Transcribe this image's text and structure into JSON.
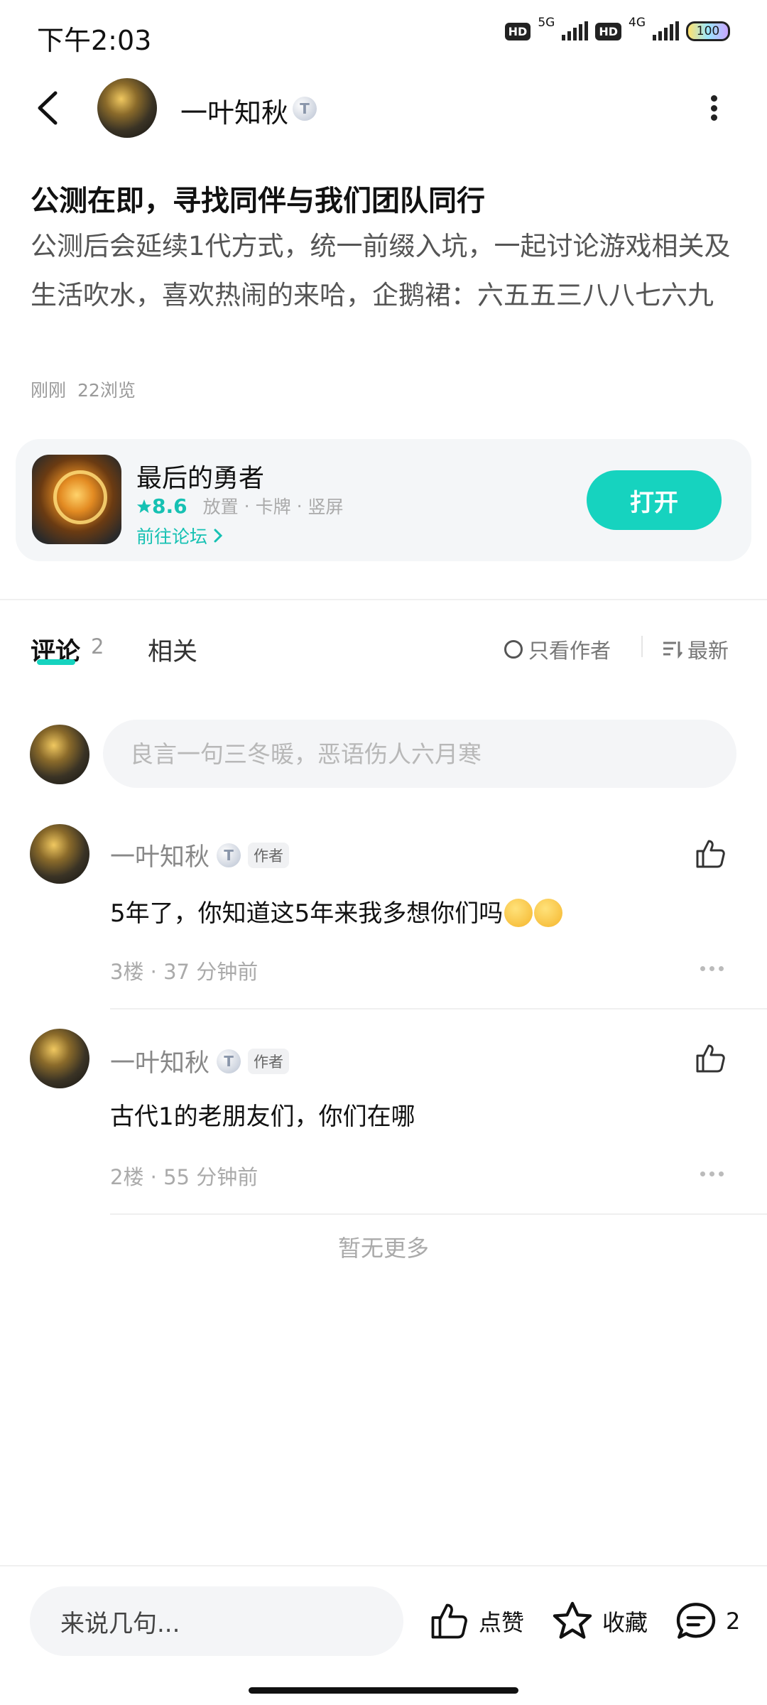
{
  "status_bar": {
    "time": "下午2:03",
    "hd1": "HD",
    "net1": "5G",
    "hd2": "HD",
    "net2": "4G",
    "battery": "100"
  },
  "header": {
    "username": "一叶知秋",
    "level_badge": "T"
  },
  "post": {
    "title": "公测在即，寻找同伴与我们团队同行",
    "body": "公测后会延续1代方式，统一前缀入坑，一起讨论游戏相关及生活吹水，喜欢热闹的来哈，企鹅裙：六五五三八八七六九",
    "time": "刚刚",
    "views": "22浏览"
  },
  "game": {
    "name": "最后的勇者",
    "rating": "8.6",
    "tags": [
      "放置",
      "卡牌",
      "竖屏"
    ],
    "tag_sep": "·",
    "forum_link": "前往论坛",
    "open_button": "打开"
  },
  "tabs": {
    "comments_label": "评论",
    "comments_count": "2",
    "related_label": "相关",
    "author_only": "只看作者",
    "sort": "最新"
  },
  "comment_input": {
    "placeholder": "良言一句三冬暖，恶语伤人六月寒"
  },
  "comments": [
    {
      "name": "一叶知秋",
      "badge": "T",
      "tag": "作者",
      "text": "5年了，你知道这5年来我多想你们吗",
      "floor": "3楼",
      "time": "37 分钟前"
    },
    {
      "name": "一叶知秋",
      "badge": "T",
      "tag": "作者",
      "text": "古代1的老朋友们，你们在哪",
      "floor": "2楼",
      "time": "55 分钟前"
    }
  ],
  "meta_sep": "·",
  "no_more": "暂无更多",
  "bottom_bar": {
    "input_placeholder": "来说几句...",
    "like_label": "点赞",
    "favorite_label": "收藏",
    "comment_count": "2"
  },
  "colors": {
    "accent": "#16d3bf"
  }
}
